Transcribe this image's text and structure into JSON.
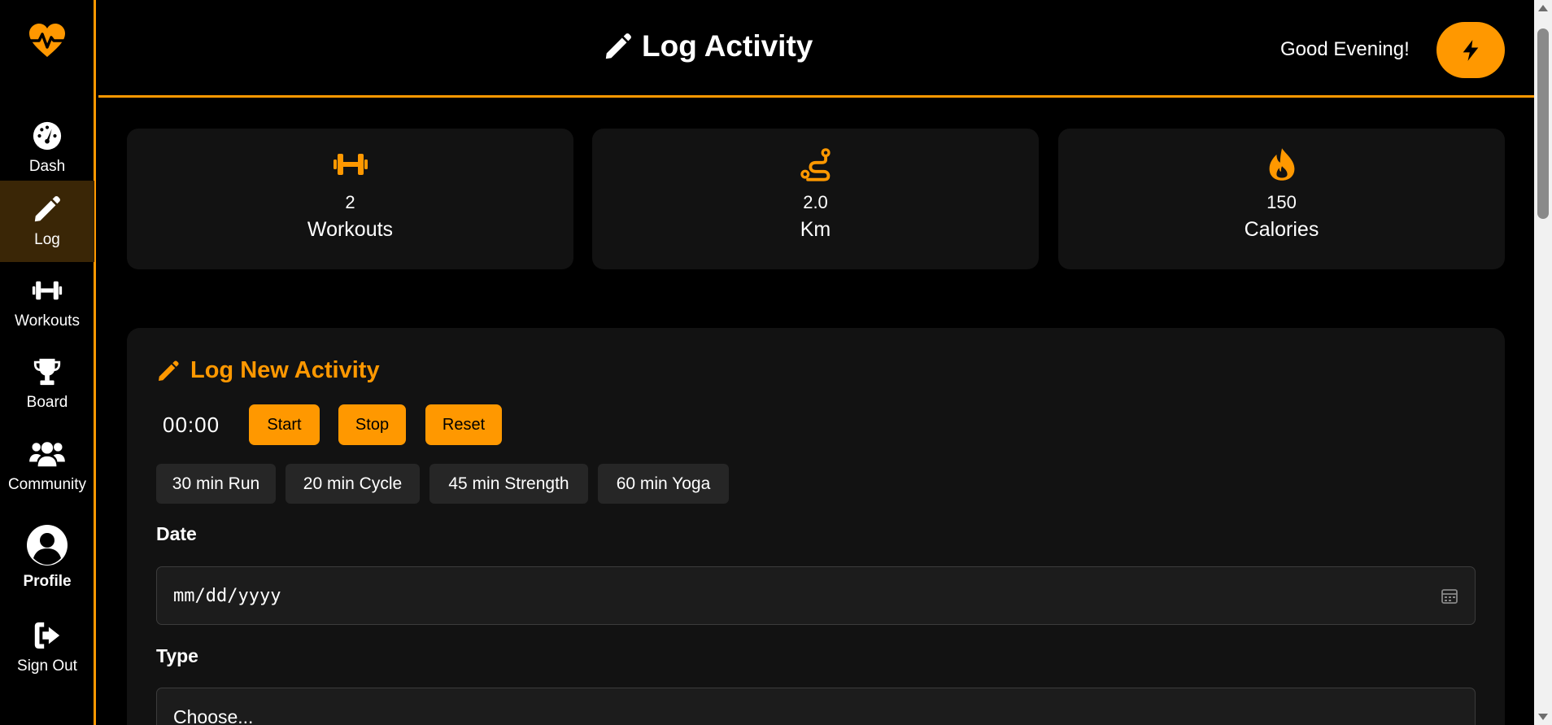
{
  "header": {
    "title": "Log Activity",
    "greeting": "Good Evening!"
  },
  "sidebar": {
    "items": [
      {
        "label": "Dash",
        "icon": "gauge-icon"
      },
      {
        "label": "Log",
        "icon": "pencil-icon",
        "active": true
      },
      {
        "label": "Workouts",
        "icon": "dumbbell-icon"
      },
      {
        "label": "Board",
        "icon": "trophy-icon"
      },
      {
        "label": "Community",
        "icon": "users-icon"
      },
      {
        "label": "Profile",
        "icon": "user-circle-icon"
      },
      {
        "label": "Sign Out",
        "icon": "sign-out-icon"
      }
    ]
  },
  "stats": [
    {
      "value": "2",
      "label": "Workouts",
      "icon": "dumbbell-icon"
    },
    {
      "value": "2.0",
      "label": "Km",
      "icon": "route-icon"
    },
    {
      "value": "150",
      "label": "Calories",
      "icon": "fire-icon"
    }
  ],
  "log": {
    "title": "Log New Activity",
    "timer": "00:00",
    "start_label": "Start",
    "stop_label": "Stop",
    "reset_label": "Reset",
    "presets": [
      "30 min Run",
      "20 min Cycle",
      "45 min Strength",
      "60 min Yoga"
    ],
    "date_label": "Date",
    "date_placeholder": "mm/dd/yyyy",
    "type_label": "Type",
    "type_value": "Choose..."
  },
  "colors": {
    "accent": "#ff9800",
    "background": "#000000",
    "card": "#121212",
    "active_nav": "#3a2606"
  }
}
